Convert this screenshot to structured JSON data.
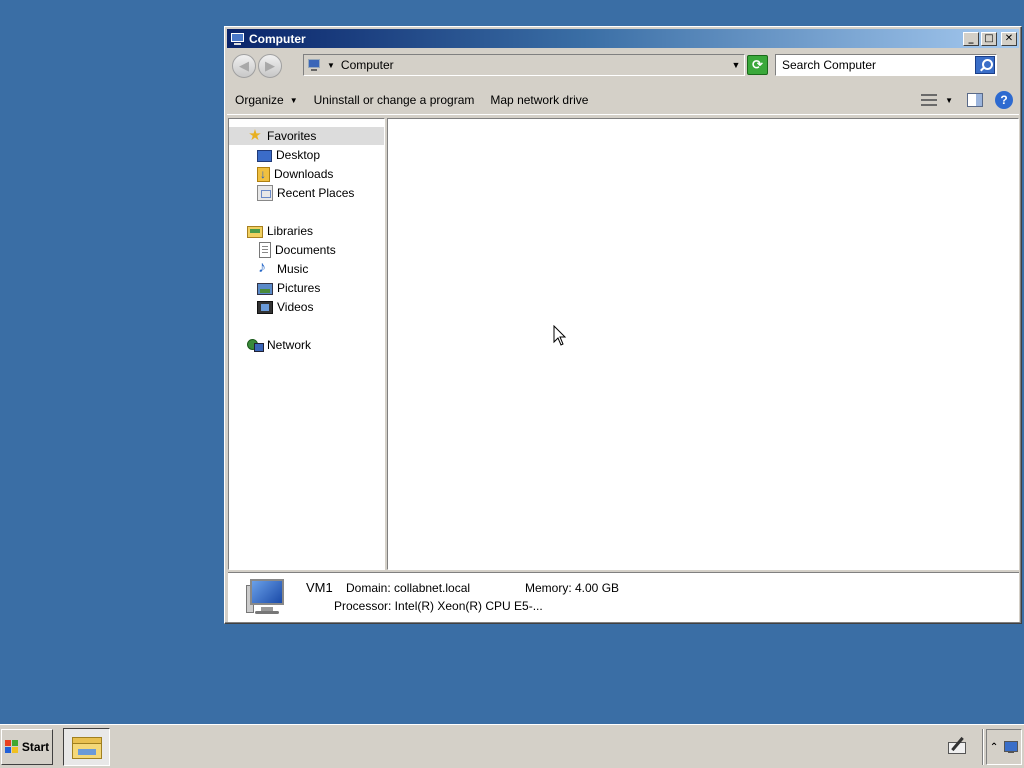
{
  "window": {
    "title": "Computer",
    "address": {
      "location": "Computer"
    },
    "search": {
      "placeholder": "Search Computer"
    },
    "toolbar": {
      "organize": "Organize",
      "uninstall": "Uninstall or change a program",
      "map_drive": "Map network drive"
    },
    "nav": {
      "favorites": "Favorites",
      "desktop": "Desktop",
      "downloads": "Downloads",
      "recent_places": "Recent Places",
      "libraries": "Libraries",
      "documents": "Documents",
      "music": "Music",
      "pictures": "Pictures",
      "videos": "Videos",
      "network": "Network"
    },
    "details": {
      "name": "VM1",
      "domain": "Domain: collabnet.local",
      "memory": "Memory: 4.00 GB",
      "processor": "Processor: Intel(R) Xeon(R) CPU E5-..."
    }
  },
  "taskbar": {
    "start": "Start"
  },
  "colors": {
    "desktop": "#3a6ea5",
    "titlebar": "#0a246a",
    "chrome": "#d4d0c8"
  }
}
